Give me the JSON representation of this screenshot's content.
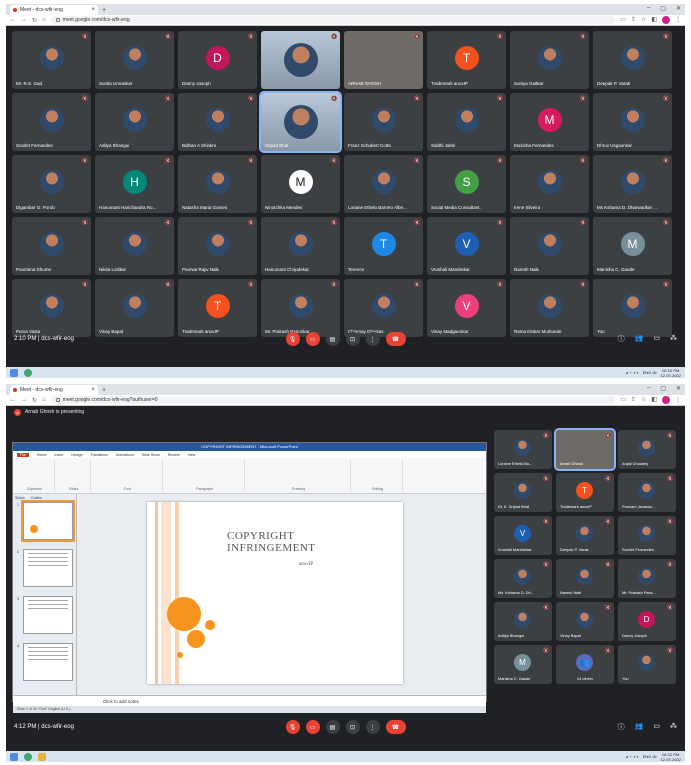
{
  "browser_top": {
    "tab_title": "Meet - dcs-wfir-eog",
    "url": "meet.google.com/dcs-wfir-eog"
  },
  "browser_bottom": {
    "tab_title": "Meet - dcs-wfir-eog",
    "url": "meet.google.com/dcs-wfir-eog?authuser=0"
  },
  "grid": [
    {
      "name": "Mr. R.S. Gad",
      "type": "photo"
    },
    {
      "name": "Sunita Umrasker",
      "type": "photo"
    },
    {
      "name": "Danny Joseph",
      "type": "letter",
      "letter": "D",
      "color": "#c2185b"
    },
    {
      "name": "",
      "type": "video"
    },
    {
      "name": "ARNAB GHOSH",
      "type": "video-gray"
    },
    {
      "name": "Trademark anovIP",
      "type": "letter",
      "letter": "T",
      "color": "#f4511e"
    },
    {
      "name": "Soniya Gaitkar",
      "type": "photo"
    },
    {
      "name": "Deepak P. Varak",
      "type": "photo"
    },
    {
      "name": "Scarlet Fernandes",
      "type": "photo"
    },
    {
      "name": "Aditya Bhangui",
      "type": "photo"
    },
    {
      "name": "Bidhan A Shinkre",
      "type": "photo"
    },
    {
      "name": "Sripad Bhat",
      "type": "video-speaking"
    },
    {
      "name": "Franz Schubert Cotta",
      "type": "photo"
    },
    {
      "name": "Siddhi Jalmi",
      "type": "photo"
    },
    {
      "name": "Mozinha Fernandes",
      "type": "letter",
      "letter": "M",
      "color": "#d81b60"
    },
    {
      "name": "Dhruv Usgaonkar",
      "type": "photo"
    },
    {
      "name": "Digambar G. Porob",
      "type": "photo"
    },
    {
      "name": "Hanumant Harichandra Ro...",
      "type": "letter",
      "letter": "H",
      "color": "#00897b"
    },
    {
      "name": "Natasha Maria Gomes",
      "type": "photo"
    },
    {
      "name": "Ninotchka Mendes",
      "type": "letter",
      "letter": "M",
      "color": "#ffffff"
    },
    {
      "name": "Loraine Ethelo Barreto Albe...",
      "type": "photo"
    },
    {
      "name": "Social Media Consultant.",
      "type": "letter",
      "letter": "S",
      "color": "#43a047"
    },
    {
      "name": "Irene Silveira",
      "type": "photo"
    },
    {
      "name": "Ms Kshama D. Dharwadkar ...",
      "type": "photo"
    },
    {
      "name": "Pournima Dhume",
      "type": "photo"
    },
    {
      "name": "Nikita Lotlikar",
      "type": "photo"
    },
    {
      "name": "Poorwa Rajiv Naik",
      "type": "photo"
    },
    {
      "name": "Hanumant Chopdekar",
      "type": "photo"
    },
    {
      "name": "Terence",
      "type": "letter",
      "letter": "T",
      "color": "#1e88e5"
    },
    {
      "name": "Vrushali Mandrekar",
      "type": "letter",
      "letter": "V",
      "color": "#1e5fb4"
    },
    {
      "name": "Naresh Naik",
      "type": "photo"
    },
    {
      "name": "Manisha C. Gaude",
      "type": "letter",
      "letter": "M",
      "color": "#78909c"
    },
    {
      "name": "Purva Vasta",
      "type": "photo"
    },
    {
      "name": "Vinay Bapat",
      "type": "photo"
    },
    {
      "name": "Trademark anovIP",
      "type": "letter",
      "letter": "T",
      "color": "#f4511e"
    },
    {
      "name": "Mr. Prakash Parionkar",
      "type": "photo"
    },
    {
      "name": "Chinmay Ghaisas",
      "type": "photo"
    },
    {
      "name": "Vinay Madgaonkar",
      "type": "letter",
      "letter": "V",
      "color": "#ec407a"
    },
    {
      "name": "Rama Dinkar Murkunde",
      "type": "photo"
    },
    {
      "name": "You",
      "type": "photo"
    }
  ],
  "meet_top": {
    "time": "2:10 PM",
    "code": "dcs-wfir-eog"
  },
  "meet_bottom": {
    "time": "4:12 PM",
    "code": "dcs-wfir-eog"
  },
  "presenting": {
    "initial": "A",
    "text": "Arnab Ghosh is presenting"
  },
  "ppt": {
    "window_title": "COPYRIGHT INFRINGEMENT - Microsoft PowerPoint",
    "tabs": [
      "File",
      "Home",
      "Insert",
      "Design",
      "Transitions",
      "Animations",
      "Slide Show",
      "Review",
      "View"
    ],
    "groups": [
      "Clipboard",
      "Slides",
      "Font",
      "Paragraph",
      "Drawing",
      "Editing"
    ],
    "thumb_tabs": [
      "Slides",
      "Outline"
    ],
    "slide_title_1": "COPYRIGHT",
    "slide_title_2": "INFRINGEMENT",
    "slide_subtitle": "anovIP",
    "notes": "Click to add notes",
    "status": "Slide 1 of 20   \"Grid\"   English (U.S.)"
  },
  "side": [
    {
      "name": "Loraine Ethelo Ba...",
      "type": "photo"
    },
    {
      "name": "Arnab Ghosh",
      "type": "video-gray"
    },
    {
      "name": "Anjali Chaubey",
      "type": "photo"
    },
    {
      "name": "Dr. K. Sripad Bhat",
      "type": "photo"
    },
    {
      "name": "Trademark anovIP",
      "type": "letter",
      "letter": "T",
      "color": "#f4511e"
    },
    {
      "name": "Poonam Janarda...",
      "type": "photo"
    },
    {
      "name": "Vrushali Mandrekar",
      "type": "letter",
      "letter": "V",
      "color": "#1e5fb4"
    },
    {
      "name": "Deepak P. Varak",
      "type": "photo"
    },
    {
      "name": "Scarlet Fernandes",
      "type": "photo"
    },
    {
      "name": "Ms. Kshama D. Dh...",
      "type": "photo"
    },
    {
      "name": "Naresh Naik",
      "type": "photo"
    },
    {
      "name": "Mr. Prakash Paric...",
      "type": "photo"
    },
    {
      "name": "Aditya Bhangui",
      "type": "photo"
    },
    {
      "name": "Vinay Bapat",
      "type": "photo"
    },
    {
      "name": "Danny Joseph",
      "type": "letter",
      "letter": "D",
      "color": "#c2185b"
    },
    {
      "name": "Manisha C. Gaude",
      "type": "letter",
      "letter": "M",
      "color": "#78909c"
    },
    {
      "name": "14 others",
      "type": "others"
    },
    {
      "name": "You",
      "type": "photo"
    }
  ],
  "taskbar": {
    "lang": "ENG IN",
    "time_top": "02:10 PM",
    "date_top": "12-07-2022",
    "time_bottom": "04:12 PM",
    "date_bottom": "12-07-2022"
  }
}
